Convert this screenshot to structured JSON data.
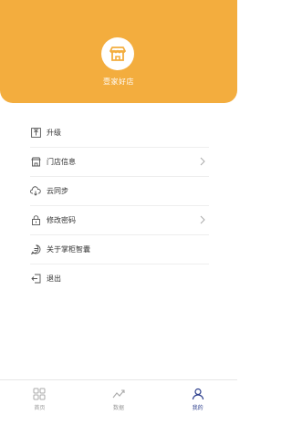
{
  "header": {
    "store_name": "壹家好店",
    "logo_icon": "store-icon"
  },
  "menu": {
    "items": [
      {
        "label": "升级",
        "icon": "upgrade-icon",
        "has_chevron": false
      },
      {
        "label": "门店信息",
        "icon": "store-info-icon",
        "has_chevron": true
      },
      {
        "label": "云同步",
        "icon": "cloud-sync-icon",
        "has_chevron": false
      },
      {
        "label": "修改密码",
        "icon": "lock-icon",
        "has_chevron": true
      },
      {
        "label": "关于掌柜智囊",
        "icon": "about-icon",
        "has_chevron": false
      },
      {
        "label": "退出",
        "icon": "logout-icon",
        "has_chevron": false
      }
    ]
  },
  "tabbar": {
    "tabs": [
      {
        "label": "首页",
        "icon": "grid-icon",
        "active": false
      },
      {
        "label": "数据",
        "icon": "trend-icon",
        "active": false
      },
      {
        "label": "我的",
        "icon": "user-icon",
        "active": true
      }
    ]
  },
  "colors": {
    "accent": "#f3ad3e",
    "active_tab": "#2c3e8c"
  }
}
